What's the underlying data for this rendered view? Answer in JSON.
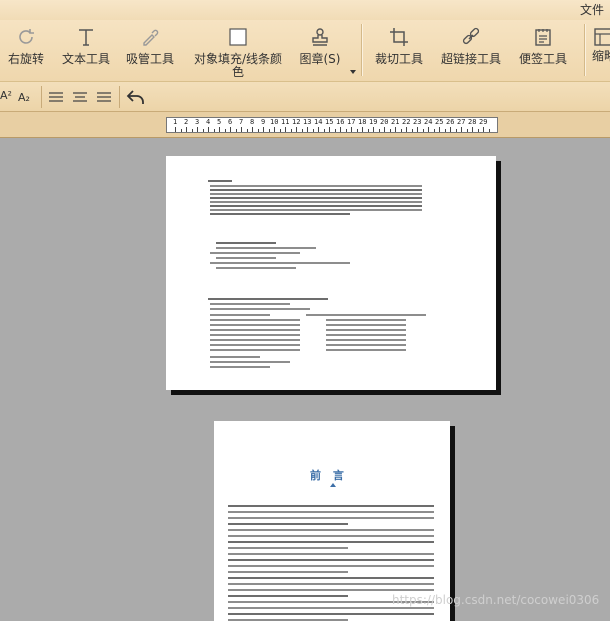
{
  "menubar": {
    "file_label": "文件"
  },
  "ribbon": {
    "tools": [
      {
        "id": "rotate-right",
        "label": "右旋转",
        "icon": "rotate-right-icon"
      },
      {
        "id": "text-tool",
        "label": "文本工具",
        "icon": "text-icon"
      },
      {
        "id": "eyedropper",
        "label": "吸管工具",
        "icon": "eyedropper-icon"
      },
      {
        "id": "object-fill",
        "label": "对象填充/线条颜\n色",
        "icon": "fill-square-icon"
      },
      {
        "id": "stamp",
        "label": "图章(S)",
        "icon": "stamp-icon"
      },
      {
        "id": "crop",
        "label": "裁切工具",
        "icon": "crop-icon"
      },
      {
        "id": "hyperlink",
        "label": "超链接工具",
        "icon": "link-icon"
      },
      {
        "id": "sticky-note",
        "label": "便签工具",
        "icon": "note-icon"
      },
      {
        "id": "thumbnail",
        "label": "缩略",
        "icon": "thumbnail-icon"
      }
    ]
  },
  "formatbar": {
    "superscript": "A²",
    "subscript": "A₂"
  },
  "ruler": {
    "numbers": [
      "1",
      "2",
      "3",
      "4",
      "5",
      "6",
      "7",
      "8",
      "9",
      "10",
      "11",
      "12",
      "13",
      "14",
      "15",
      "16",
      "17",
      "18",
      "19",
      "20",
      "21",
      "22",
      "23",
      "24",
      "25",
      "26",
      "27",
      "28",
      "29"
    ]
  },
  "pages": {
    "page2_title": "前 言"
  },
  "watermark": "https://blog.csdn.net/cocowei0306"
}
